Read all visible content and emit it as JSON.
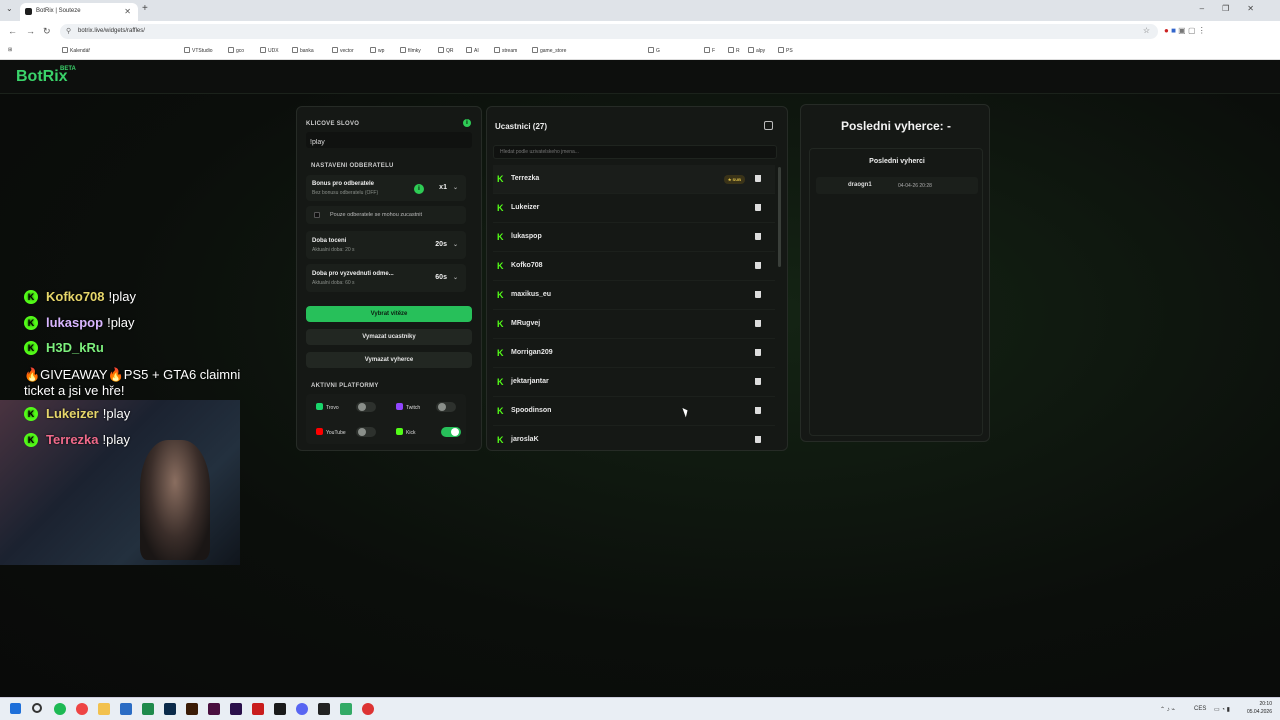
{
  "browser": {
    "tab_title": "BotRix | Souteze",
    "url": "botrix.live/widgets/raffles/",
    "bookmarks": [
      "Kalendář",
      "VTStudio",
      "gco",
      "UDX",
      "banka",
      "vector",
      "wp",
      "filmky",
      "QR",
      "AI",
      "stream",
      "game_store",
      "G",
      "F",
      "R",
      "alpy",
      "PS"
    ]
  },
  "brand": {
    "name": "BotRix",
    "badge": "BETA"
  },
  "overlay": {
    "chat": [
      {
        "user": "Kofko708",
        "message": "!play"
      },
      {
        "user": "lukaspop",
        "message": "!play"
      },
      {
        "user": "H3D_kRu",
        "message": ""
      },
      {
        "user": "",
        "message": "🔥GIVEAWAY🔥PS5 + GTA6 claimni ticket a jsi ve hře!"
      },
      {
        "user": "Lukeizer",
        "message": "!play"
      },
      {
        "user": "Terrezka",
        "message": "!play"
      }
    ]
  },
  "settings": {
    "keyword_label": "KLICOVE SLOVO",
    "keyword_value": "!play",
    "subs_section_label": "NASTAVENI ODBERATELU",
    "bonus_title": "Bonus pro odberatele",
    "bonus_sub": "Bez bonusu odberatelu (OFF)",
    "bonus_value": "x1",
    "subs_only_label": "Pouze odberatele se mohou zucastnit",
    "spin_title": "Doba toceni",
    "spin_sub": "Aktualni doba: 20 s",
    "spin_value": "20s",
    "claim_title": "Doba pro vyzvednuti odme...",
    "claim_sub": "Aktualni doba: 60 s",
    "claim_value": "60s",
    "pick_winner": "Vybrat vitěze",
    "clear_participants": "Vymazat ucastniky",
    "clear_winners": "Vymazat vyherce",
    "platforms_label": "AKTIVNI PLATFORMY",
    "platforms": [
      {
        "name": "Trovo",
        "on": false
      },
      {
        "name": "Twitch",
        "on": false
      },
      {
        "name": "YouTube",
        "on": false
      },
      {
        "name": "Kick",
        "on": true
      }
    ]
  },
  "participants": {
    "title": "Ucastnici (27)",
    "search_placeholder": "Hledat podle uzivatelskeho jmena...",
    "sub_badge": "★ SUB",
    "list": [
      "Terrezka",
      "Lukeizer",
      "lukaspop",
      "Kofko708",
      "maxikus_eu",
      "MRugvej",
      "Morrigan209",
      "jektarjantar",
      "Spoodinson",
      "jaroslaK"
    ]
  },
  "winners": {
    "title": "Posledni vyherce: -",
    "subtitle": "Posledni vyherci",
    "list": [
      {
        "name": "draogn1",
        "date": "04-04-26 20:28"
      }
    ]
  },
  "taskbar": {
    "time": "20:10",
    "date": "05.04.2026",
    "lang": "CES"
  },
  "colors": {
    "accent": "#27c05a",
    "kick": "#53fc18",
    "background": "#0b0d0b"
  }
}
